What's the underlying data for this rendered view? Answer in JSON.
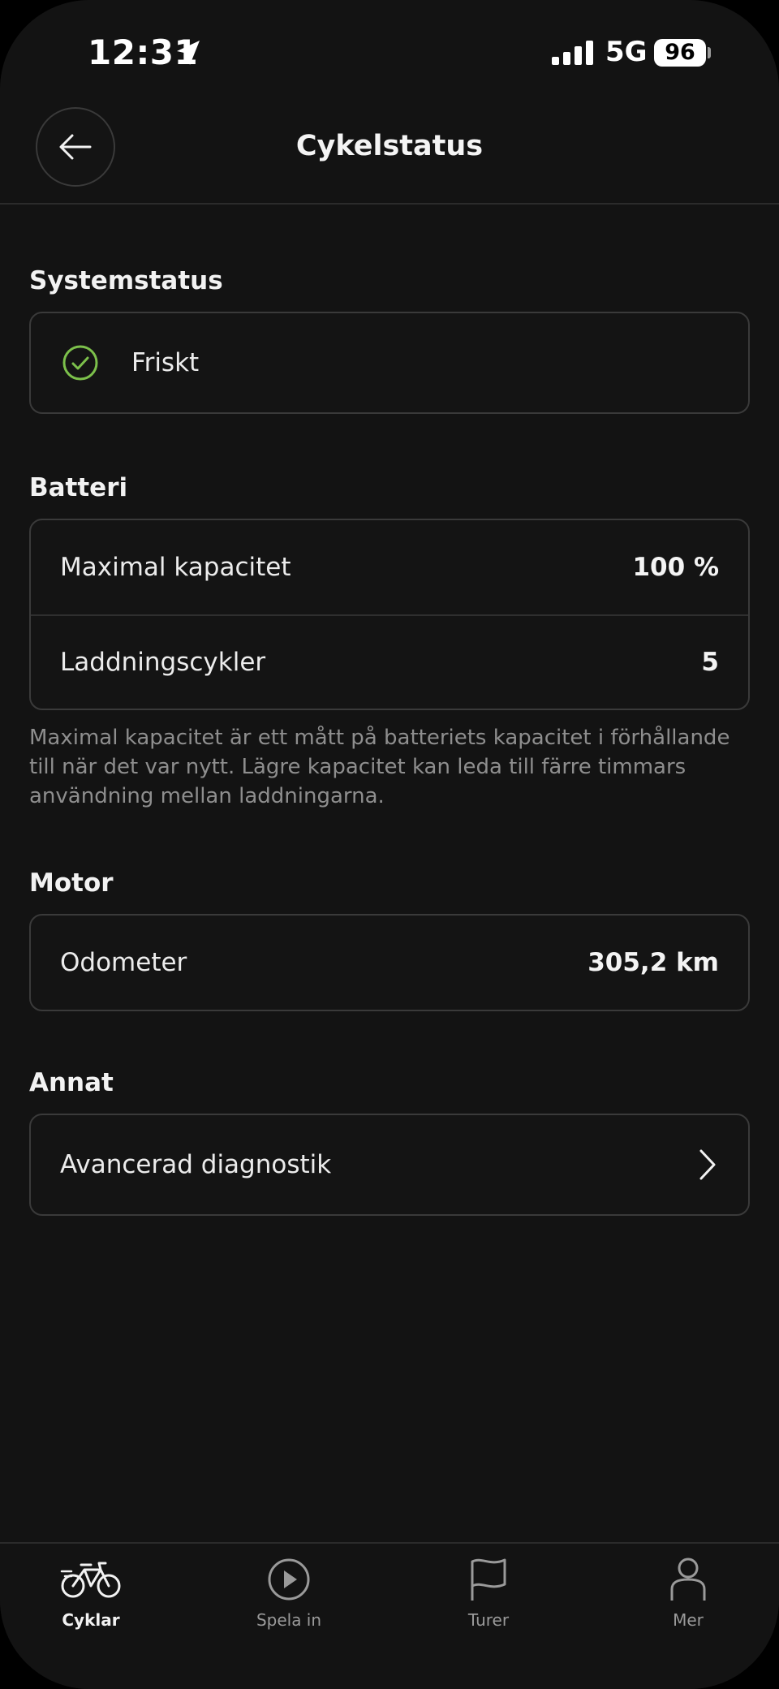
{
  "status_bar": {
    "time": "12:31",
    "network": "5G",
    "battery": "96"
  },
  "header": {
    "title": "Cykelstatus"
  },
  "system": {
    "label": "Systemstatus",
    "status": "Friskt"
  },
  "battery_section": {
    "label": "Batteri",
    "rows": [
      {
        "label": "Maximal kapacitet",
        "value": "100 %"
      },
      {
        "label": "Laddningscykler",
        "value": "5"
      }
    ],
    "note": "Maximal kapacitet är ett mått på batteriets kapacitet i förhållande till när det var nytt. Lägre kapacitet kan leda till färre timmars användning mellan laddningarna."
  },
  "motor": {
    "label": "Motor",
    "rows": [
      {
        "label": "Odometer",
        "value": "305,2 km"
      }
    ]
  },
  "other": {
    "label": "Annat",
    "rows": [
      {
        "label": "Avancerad diagnostik"
      }
    ]
  },
  "tabs": [
    {
      "label": "Cyklar",
      "icon": "bike-icon",
      "active": true
    },
    {
      "label": "Spela in",
      "icon": "play-icon"
    },
    {
      "label": "Turer",
      "icon": "flag-icon"
    },
    {
      "label": "Mer",
      "icon": "person-icon"
    }
  ],
  "colors": {
    "background": "#131313",
    "accent_green": "#7cc04b",
    "border": "#3a3a3a"
  }
}
